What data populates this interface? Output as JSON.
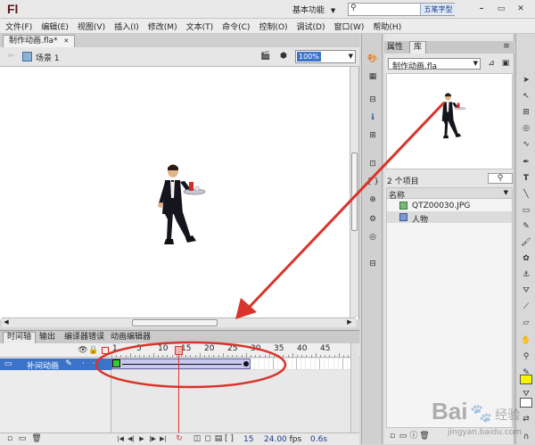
{
  "app": {
    "logo": "Fl",
    "workspace": "基本功能",
    "search_placeholder": "",
    "watermark_brand": "五笔字型"
  },
  "menu": [
    "文件(F)",
    "编辑(E)",
    "视图(V)",
    "插入(I)",
    "修改(M)",
    "文本(T)",
    "命令(C)",
    "控制(O)",
    "调试(D)",
    "窗口(W)",
    "帮助(H)"
  ],
  "document": {
    "tab": "制作动画.fla*",
    "scene": "场景 1",
    "zoom": "100%"
  },
  "library": {
    "tabs": [
      "属性",
      "库"
    ],
    "file": "制作动画.fla",
    "count": "2 个项目",
    "header_name": "名称",
    "items": [
      "QTZ00030.JPG",
      "人物"
    ]
  },
  "timeline": {
    "tabs": [
      "时间轴",
      "输出",
      "编译器错误",
      "动画编辑器"
    ],
    "layer": "补间动画",
    "ruler": [
      "1",
      "5",
      "10",
      "15",
      "20",
      "25",
      "30",
      "35",
      "40",
      "45"
    ],
    "current_frame": "15",
    "fps": "24.00",
    "fps_unit": "fps",
    "time": "0.6s",
    "playhead_frame": 15,
    "tween_start": 1,
    "tween_end": 30
  },
  "watermark": {
    "brand_text": "Bai",
    "brand_suffix": "经验",
    "url": "jingyan.baidu.com"
  },
  "colors": {
    "accent": "#d9342b",
    "selection": "#3a73c8",
    "tween": "#c8c8f0",
    "keyframe": "#33cc33"
  }
}
